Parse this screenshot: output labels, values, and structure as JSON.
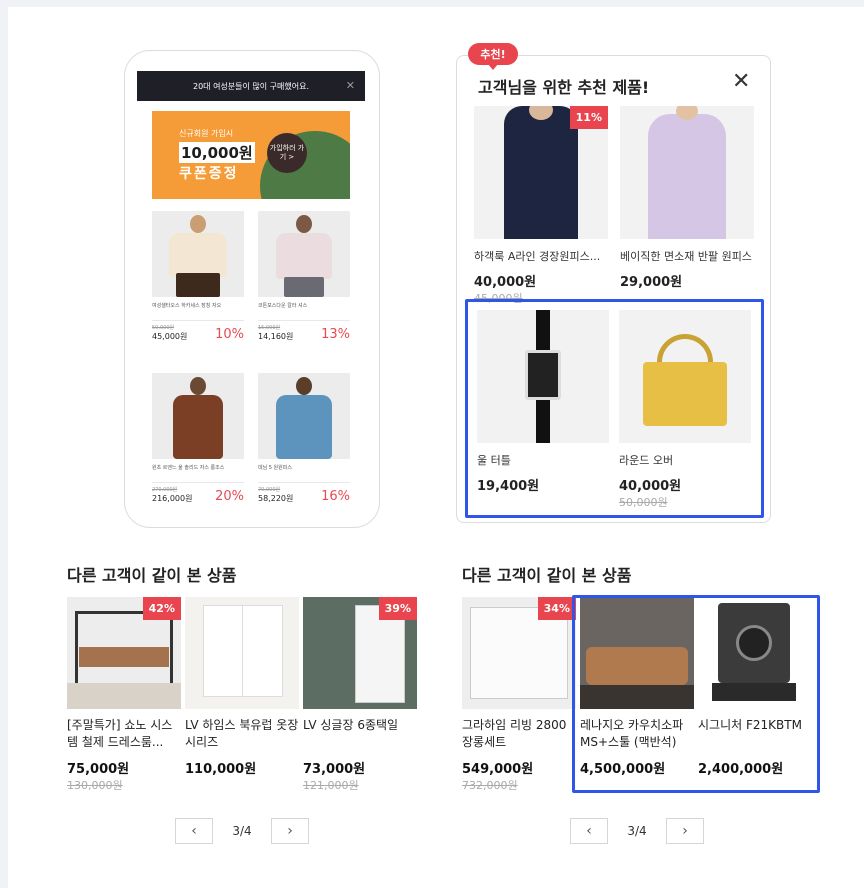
{
  "phone": {
    "notice": "20대 여성분들이 많이 구매했어요.",
    "close_icon": "close-icon",
    "banner": {
      "line1": "신규회원 가입시",
      "line2": "10,000원",
      "line3": "쿠폰증정",
      "cta": "가입하러 가기 >"
    },
    "products": [
      {
        "name": "여성셀타오스 하카세스 장칭 자오",
        "old": "50,000원",
        "price": "45,000원",
        "discount": "10%"
      },
      {
        "name": "코튼포스다운 칼라 셔스",
        "old": "15,000원",
        "price": "14,160원",
        "discount": "13%"
      },
      {
        "name": "원초 르엔느 울 솔리드 자스 롱조스",
        "old": "270,000원",
        "price": "216,000원",
        "discount": "20%"
      },
      {
        "name": "데님 5 원원피스",
        "old": "70,000원",
        "price": "58,220원",
        "discount": "16%"
      }
    ]
  },
  "recommend": {
    "badge": "추천!",
    "title": "고객님을 위한 추천 제품!",
    "close_icon": "close-icon",
    "products": [
      {
        "name": "하객룩 A라인 경장원피스...",
        "price": "40,000원",
        "old": "45,000원",
        "discount": "11%"
      },
      {
        "name": "베이직한 면소재 반팔 원피스",
        "price": "29,000원",
        "old": ""
      },
      {
        "name": "울 터틀",
        "price": "19,400원",
        "old": ""
      },
      {
        "name": "라운드 오버",
        "price": "40,000원",
        "old": "50,000원"
      }
    ]
  },
  "section_left": {
    "title": "다른 고객이 같이 본 상품",
    "products": [
      {
        "name": "[주말특가] 쇼노 시스템 철제 드레스룸...",
        "price": "75,000원",
        "old": "130,000원",
        "discount": "42%"
      },
      {
        "name": "LV 하임스 북유럽 옷장 시리즈",
        "price": "110,000원",
        "old": ""
      },
      {
        "name": "LV 싱글장 6종택일",
        "price": "73,000원",
        "old": "121,000원",
        "discount": "39%"
      }
    ],
    "pager": {
      "page": "3/4",
      "prev_icon": "chevron-left-icon",
      "next_icon": "chevron-right-icon"
    }
  },
  "section_right": {
    "title": "다른 고객이 같이 본 상품",
    "products": [
      {
        "name": "그라하임 리빙 2800 장롱세트",
        "price": "549,000원",
        "old": "732,000원",
        "discount": "34%"
      },
      {
        "name": "레나지오 카우치소파 MS+스툴 (맥반석)",
        "price": "4,500,000원",
        "old": ""
      },
      {
        "name": "시그니처 F21KBTM",
        "price": "2,400,000원",
        "old": ""
      }
    ],
    "pager": {
      "page": "3/4",
      "prev_icon": "chevron-left-icon",
      "next_icon": "chevron-right-icon"
    }
  },
  "colors": {
    "accent_red": "#e8454e",
    "highlight_blue": "#2f56e8",
    "banner_orange": "#f59c38"
  }
}
